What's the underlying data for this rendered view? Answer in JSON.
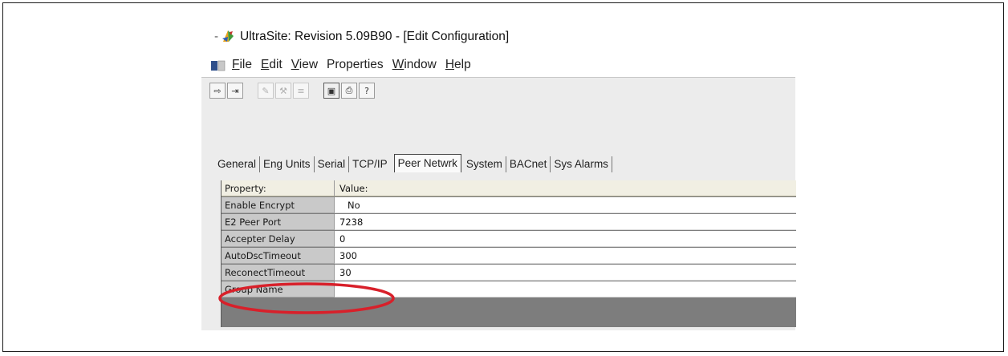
{
  "window": {
    "title": "UltraSite: Revision 5.09B90 - [Edit Configuration]",
    "sys_menu_glyph": "-"
  },
  "menu": {
    "items": [
      {
        "mnemonic": "F",
        "rest": "ile"
      },
      {
        "mnemonic": "E",
        "rest": "dit"
      },
      {
        "mnemonic": "V",
        "rest": "iew"
      },
      {
        "mnemonic": "",
        "rest": "Properties"
      },
      {
        "mnemonic": "W",
        "rest": "indow"
      },
      {
        "mnemonic": "H",
        "rest": "elp"
      }
    ]
  },
  "toolbar": {
    "icons": [
      "connect-icon",
      "disconnect-icon",
      "edit-icon",
      "tool-icon",
      "list-icon",
      "window-icon",
      "print-icon",
      "help-icon"
    ]
  },
  "tabs": [
    "General",
    "Eng Units",
    "Serial",
    "TCP/IP",
    "Peer Netwrk",
    "System",
    "BACnet",
    "Sys Alarms"
  ],
  "active_tab": "Peer Netwrk",
  "grid": {
    "header": {
      "property": "Property:",
      "value": "Value:"
    },
    "rows": [
      {
        "property": "Enable Encrypt",
        "value": "No"
      },
      {
        "property": "E2 Peer Port",
        "value": "7238"
      },
      {
        "property": "Accepter Delay",
        "value": "0"
      },
      {
        "property": "AutoDscTimeout",
        "value": "300"
      },
      {
        "property": "ReconectTimeout",
        "value": "30"
      },
      {
        "property": "Group Name",
        "value": ""
      }
    ]
  },
  "colors": {
    "highlight_ellipse": "#d8202a",
    "grid_background": "#7d7d7d",
    "property_cell": "#c9c9c9"
  }
}
